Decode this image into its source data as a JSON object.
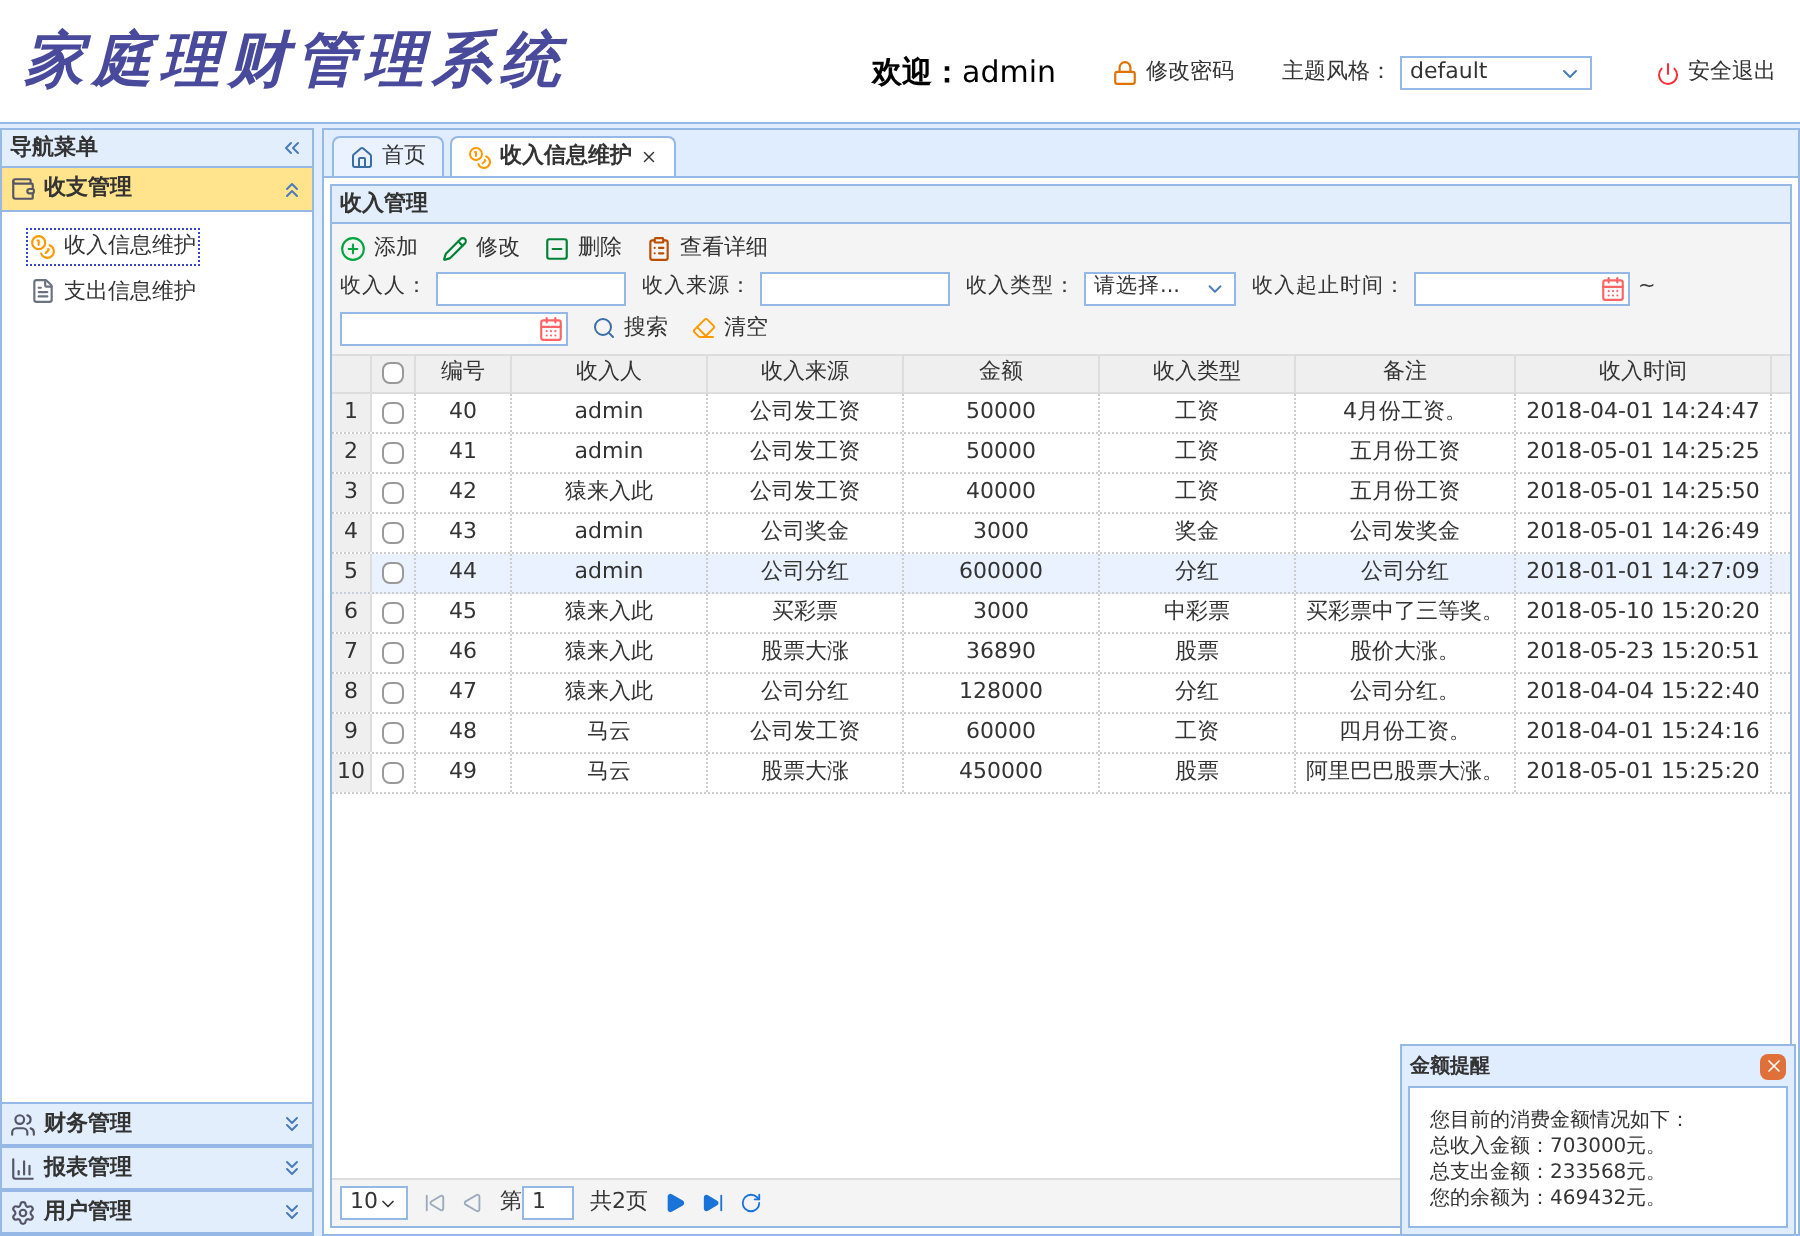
{
  "header": {
    "logo": "家庭理财管理系统",
    "welcome_label": "欢迎：",
    "user": "admin",
    "change_password": "修改密码",
    "theme_label": "主题风格：",
    "theme_value": "default",
    "logout": "安全退出"
  },
  "sidebar": {
    "title": "导航菜单",
    "sections": [
      {
        "label": "收支管理",
        "expanded": true,
        "items": [
          {
            "label": "收入信息维护",
            "selected": true
          },
          {
            "label": "支出信息维护",
            "selected": false
          }
        ]
      },
      {
        "label": "财务管理",
        "expanded": false
      },
      {
        "label": "报表管理",
        "expanded": false
      },
      {
        "label": "用户管理",
        "expanded": false
      }
    ]
  },
  "tabs": [
    {
      "label": "首页",
      "selected": false,
      "closable": false
    },
    {
      "label": "收入信息维护",
      "selected": true,
      "closable": true
    }
  ],
  "panel": {
    "title": "收入管理",
    "toolbar": [
      "添加",
      "修改",
      "删除",
      "查看详细"
    ],
    "filters": {
      "payer_label": "收入人：",
      "source_label": "收入来源：",
      "type_label": "收入类型：",
      "type_value": "请选择...",
      "time_label": "收入起止时间：",
      "range_sep": "~",
      "search": "搜索",
      "clear": "清空"
    },
    "table": {
      "select_all_checked": false,
      "columns": [
        "编号",
        "收入人",
        "收入来源",
        "金额",
        "收入类型",
        "备注",
        "收入时间"
      ],
      "rows": [
        {
          "index": "1",
          "selected": false,
          "checked": false,
          "cells": [
            "40",
            "admin",
            "公司发工资",
            "50000",
            "工资",
            "4月份工资。",
            "2018-04-01 14:24:47"
          ]
        },
        {
          "index": "2",
          "selected": false,
          "checked": false,
          "cells": [
            "41",
            "admin",
            "公司发工资",
            "50000",
            "工资",
            "五月份工资",
            "2018-05-01 14:25:25"
          ]
        },
        {
          "index": "3",
          "selected": false,
          "checked": false,
          "cells": [
            "42",
            "猿来入此",
            "公司发工资",
            "40000",
            "工资",
            "五月份工资",
            "2018-05-01 14:25:50"
          ]
        },
        {
          "index": "4",
          "selected": false,
          "checked": false,
          "cells": [
            "43",
            "admin",
            "公司奖金",
            "3000",
            "奖金",
            "公司发奖金",
            "2018-05-01 14:26:49"
          ]
        },
        {
          "index": "5",
          "selected": true,
          "checked": false,
          "cells": [
            "44",
            "admin",
            "公司分红",
            "600000",
            "分红",
            "公司分红",
            "2018-01-01 14:27:09"
          ]
        },
        {
          "index": "6",
          "selected": false,
          "checked": false,
          "cells": [
            "45",
            "猿来入此",
            "买彩票",
            "3000",
            "中彩票",
            "买彩票中了三等奖。",
            "2018-05-10 15:20:20"
          ]
        },
        {
          "index": "7",
          "selected": false,
          "checked": false,
          "cells": [
            "46",
            "猿来入此",
            "股票大涨",
            "36890",
            "股票",
            "股价大涨。",
            "2018-05-23 15:20:51"
          ]
        },
        {
          "index": "8",
          "selected": false,
          "checked": false,
          "cells": [
            "47",
            "猿来入此",
            "公司分红",
            "128000",
            "分红",
            "公司分红。",
            "2018-04-04 15:22:40"
          ]
        },
        {
          "index": "9",
          "selected": false,
          "checked": false,
          "cells": [
            "48",
            "马云",
            "公司发工资",
            "60000",
            "工资",
            "四月份工资。",
            "2018-04-01 15:24:16"
          ]
        },
        {
          "index": "10",
          "selected": false,
          "checked": false,
          "cells": [
            "49",
            "马云",
            "股票大涨",
            "450000",
            "股票",
            "阿里巴巴股票大涨。",
            "2018-05-01 15:25:20"
          ]
        }
      ]
    },
    "pagination": {
      "page_size": "10",
      "page_label": "第",
      "page": "1",
      "total": "共2页"
    }
  },
  "popup": {
    "title": "金额提醒",
    "lines": [
      "您目前的消费金额情况如下：",
      "总收入金额：703000元。",
      "总支出金额：233568元。",
      "您的余额为：469432元。"
    ]
  }
}
